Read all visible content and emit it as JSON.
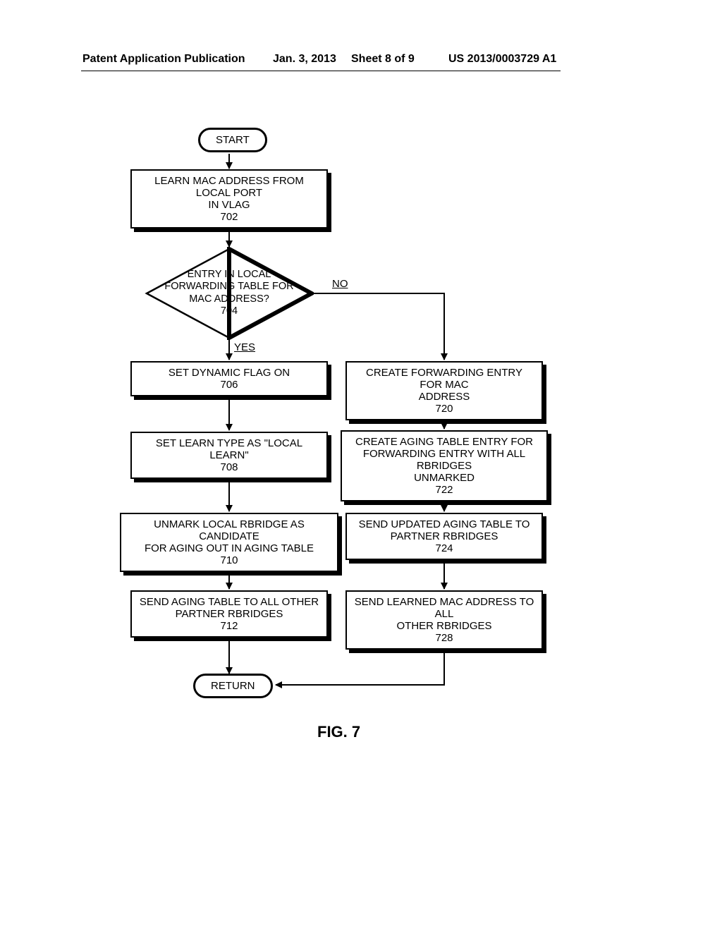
{
  "header": {
    "pub": "Patent Application Publication",
    "date": "Jan. 3, 2013",
    "sheet": "Sheet 8 of 9",
    "docnum": "US 2013/0003729 A1"
  },
  "nodes": {
    "start": "START",
    "n702_l1": "LEARN MAC ADDRESS FROM LOCAL PORT",
    "n702_l2": "IN VLAG",
    "n702_l3": "702",
    "d704_l1": "ENTRY IN LOCAL",
    "d704_l2": "FORWARDING TABLE FOR",
    "d704_l3": "MAC ADDRESS?",
    "d704_l4": "704",
    "yes": "YES",
    "no": "NO",
    "n706_l1": "SET DYNAMIC FLAG ON",
    "n706_l2": "706",
    "n708_l1": "SET LEARN TYPE AS \"LOCAL LEARN\"",
    "n708_l2": "708",
    "n710_l1": "UNMARK LOCAL RBRIDGE AS CANDIDATE",
    "n710_l2": "FOR AGING OUT IN AGING TABLE",
    "n710_l3": "710",
    "n712_l1": "SEND AGING TABLE TO ALL OTHER",
    "n712_l2": "PARTNER RBRIDGES",
    "n712_l3": "712",
    "n720_l1": "CREATE FORWARDING ENTRY FOR MAC",
    "n720_l2": "ADDRESS",
    "n720_l3": "720",
    "n722_l1": "CREATE AGING TABLE ENTRY FOR",
    "n722_l2": "FORWARDING ENTRY WITH ALL RBRIDGES",
    "n722_l3": "UNMARKED",
    "n722_l4": "722",
    "n724_l1": "SEND UPDATED AGING TABLE TO",
    "n724_l2": "PARTNER RBRIDGES",
    "n724_l3": "724",
    "n728_l1": "SEND LEARNED MAC ADDRESS TO ALL",
    "n728_l2": "OTHER RBRIDGES",
    "n728_l3": "728",
    "return": "RETURN"
  },
  "figure": "FIG. 7"
}
